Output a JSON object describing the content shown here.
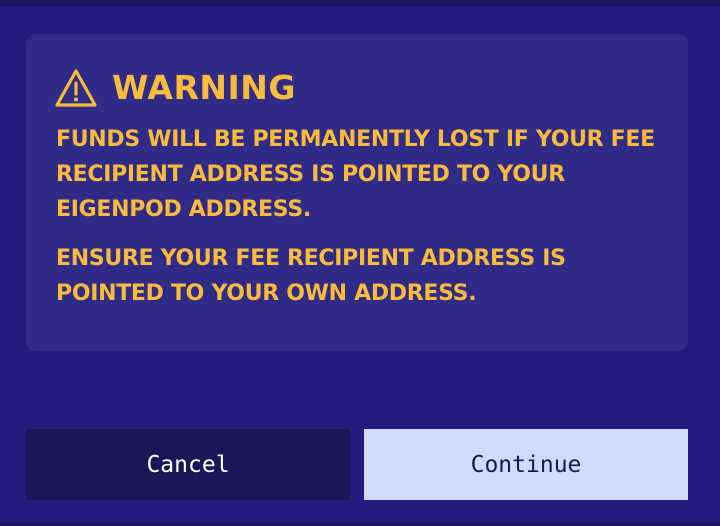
{
  "warning": {
    "icon": "warning-triangle-icon",
    "title": "WARNING",
    "message_1": "FUNDS WILL BE PERMANENTLY LOST IF YOUR FEE RECIPIENT ADDRESS IS POINTED TO YOUR EIGENPOD ADDRESS.",
    "message_2": "ENSURE YOUR FEE RECIPIENT ADDRESS IS POINTED TO YOUR OWN ADDRESS."
  },
  "actions": {
    "cancel_label": "Cancel",
    "continue_label": "Continue"
  },
  "colors": {
    "background": "#231c7e",
    "panel": "#2f2b86",
    "warning_text": "#f8bb3d",
    "cancel_button": "#1b1658",
    "continue_button": "#cfdcfd"
  }
}
